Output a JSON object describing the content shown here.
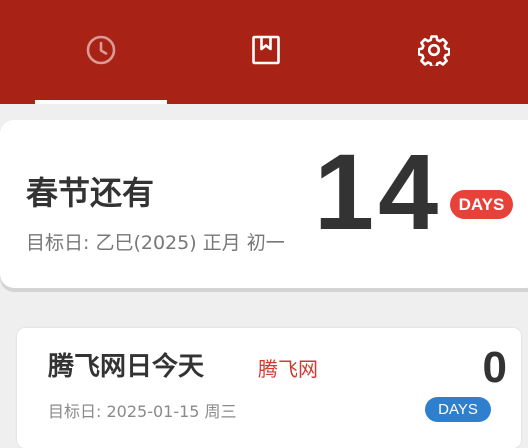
{
  "header": {
    "color": "#a92216",
    "tabs": [
      {
        "icon": "clock-icon",
        "active": true
      },
      {
        "icon": "bookmark-icon",
        "active": false
      },
      {
        "icon": "gear-icon",
        "active": false
      }
    ]
  },
  "featured": {
    "title": "春节还有",
    "target": "目标日: 乙巳(2025) 正月 初一",
    "days": "14",
    "unit": "DAYS",
    "badge_color": "#e8413a"
  },
  "events": [
    {
      "title": "腾飞网日今天",
      "brand": "腾飞网",
      "target": "目标日: 2025-01-15 周三",
      "days": "0",
      "unit": "DAYS",
      "badge_color": "#2f7fcf"
    }
  ]
}
